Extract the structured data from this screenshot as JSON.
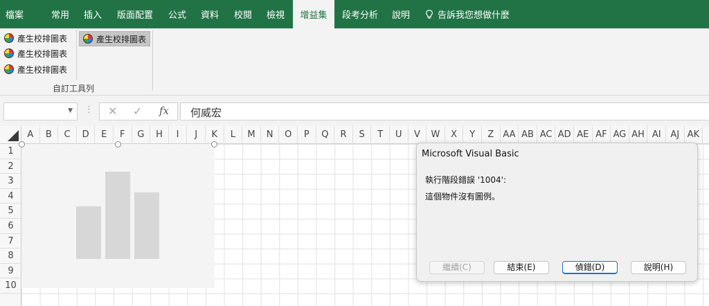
{
  "ribbon_tabs": [
    {
      "label": "檔案"
    },
    {
      "label": "常用"
    },
    {
      "label": "插入"
    },
    {
      "label": "版面配置"
    },
    {
      "label": "公式"
    },
    {
      "label": "資料"
    },
    {
      "label": "校閱"
    },
    {
      "label": "檢視"
    },
    {
      "label": "增益集",
      "active": true
    },
    {
      "label": "段考分析"
    },
    {
      "label": "說明"
    },
    {
      "label": "告訴我您想做什麼"
    }
  ],
  "ribbon": {
    "small_buttons": [
      "產生校排圖表",
      "產生校排圖表",
      "產生校排圖表"
    ],
    "large_button": "產生校排圖表",
    "group_label": "自訂工具列"
  },
  "formula_bar": {
    "name_box": "",
    "cancel_glyph": "✕",
    "enter_glyph": "✓",
    "fx_label": "fx",
    "content": "何威宏"
  },
  "columns": [
    "A",
    "B",
    "C",
    "D",
    "E",
    "F",
    "G",
    "H",
    "I",
    "J",
    "K",
    "L",
    "M",
    "N",
    "O",
    "P",
    "Q",
    "R",
    "S",
    "T",
    "U",
    "V",
    "W",
    "X",
    "Y",
    "Z",
    "AA",
    "AB",
    "AC",
    "AD",
    "AE",
    "AF",
    "AG",
    "AH",
    "AI",
    "AJ",
    "AK"
  ],
  "rows": [
    "1",
    "2",
    "3",
    "4",
    "5",
    "6",
    "7",
    "8",
    "9",
    "10"
  ],
  "chart_placeholder": {
    "bar_heights": [
      0.6,
      1.0,
      0.76
    ]
  },
  "dialog": {
    "title": "Microsoft Visual Basic",
    "message_line1": "執行階段錯誤 '1004':",
    "message_line2": "這個物件沒有圖例。",
    "buttons": {
      "continue": "繼續(C)",
      "end": "結束(E)",
      "debug": "偵錯(D)",
      "help": "說明(H)"
    }
  },
  "colors": {
    "excel_green": "#217346",
    "ribbon_bg": "#f3f3f3",
    "grid_line": "#e1e1e1"
  }
}
